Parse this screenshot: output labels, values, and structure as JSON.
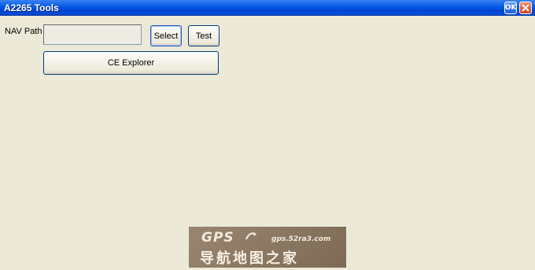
{
  "window": {
    "title": "A2265 Tools"
  },
  "titlebar": {
    "ok_label": "OK",
    "close_icon": "close-icon"
  },
  "form": {
    "nav_label": "NAV Path",
    "nav_value": "",
    "select_label": "Select",
    "test_label": "Test",
    "ce_explorer_label": "CE Explorer"
  },
  "watermark": {
    "brand": "GPS",
    "url": "gps.52ra3.com",
    "chinese": "导航地图之家"
  },
  "colors": {
    "background": "#ece9d8",
    "titlebar": "#0a5ee7",
    "close": "#d3421f"
  }
}
